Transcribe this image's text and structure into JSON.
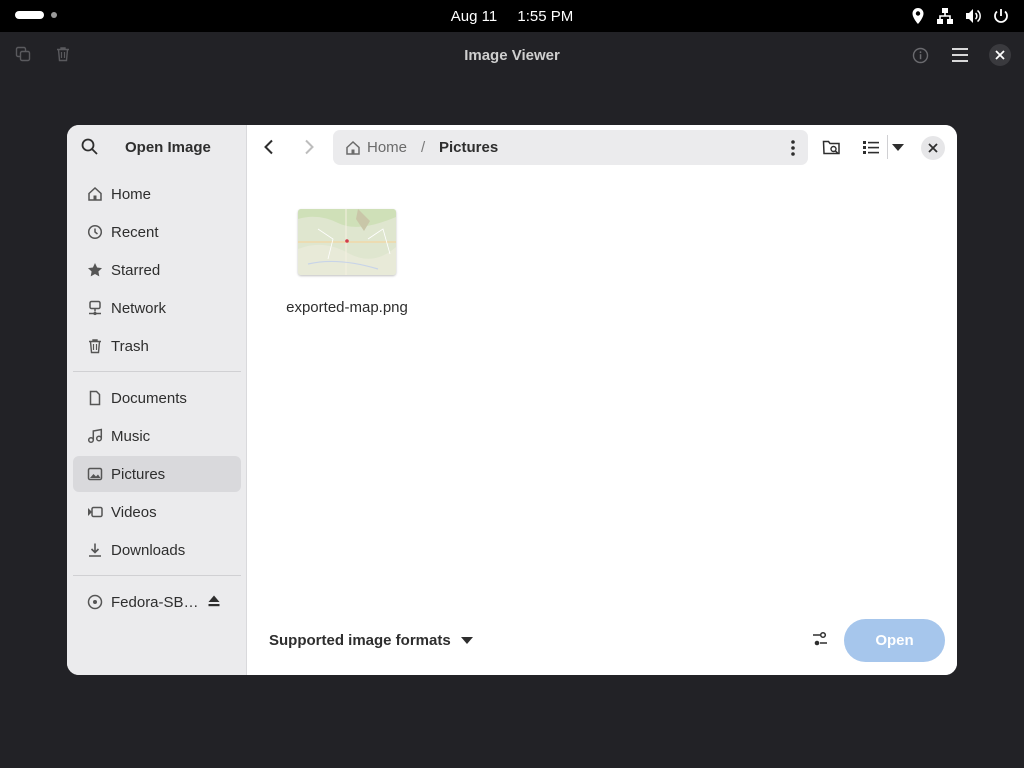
{
  "topbar": {
    "date": "Aug 11",
    "time": "1:55 PM",
    "icons": [
      "location-icon",
      "network-icon",
      "volume-icon",
      "power-icon"
    ]
  },
  "app": {
    "title": "Image Viewer",
    "left_icons": [
      "copy-icon",
      "trash-icon"
    ],
    "right_icons": [
      "info-icon",
      "hamburger-menu-icon",
      "close-icon"
    ]
  },
  "dialog": {
    "title": "Open Image",
    "sidebar": {
      "places": [
        {
          "label": "Home",
          "icon": "home-icon"
        },
        {
          "label": "Recent",
          "icon": "clock-icon"
        },
        {
          "label": "Starred",
          "icon": "star-icon"
        },
        {
          "label": "Network",
          "icon": "network-drive-icon"
        },
        {
          "label": "Trash",
          "icon": "trash-icon"
        }
      ],
      "bookmarks": [
        {
          "label": "Documents",
          "icon": "document-icon"
        },
        {
          "label": "Music",
          "icon": "music-icon"
        },
        {
          "label": "Pictures",
          "icon": "image-icon",
          "active": true
        },
        {
          "label": "Videos",
          "icon": "video-icon"
        },
        {
          "label": "Downloads",
          "icon": "download-icon"
        }
      ],
      "devices": [
        {
          "label": "Fedora-SB…",
          "icon": "disc-icon",
          "action_icon": "eject-icon"
        }
      ]
    },
    "path": {
      "home": "Home",
      "separator": "/",
      "current": "Pictures"
    },
    "files": [
      {
        "name": "exported-map.png"
      }
    ],
    "filter": "Supported image formats",
    "open_label": "Open",
    "accent": "#a6c6ec"
  }
}
